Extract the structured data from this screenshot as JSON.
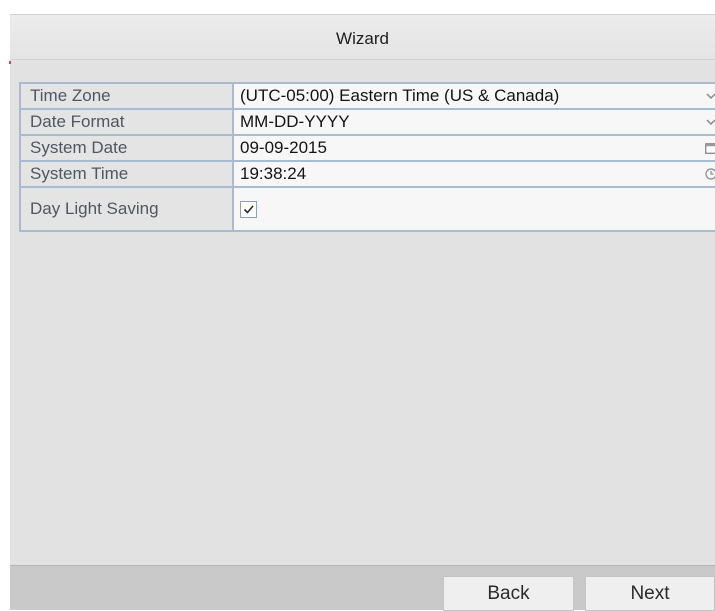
{
  "window": {
    "title": "Wizard"
  },
  "form": {
    "rows": [
      {
        "label": "Time Zone",
        "value": "(UTC-05:00) Eastern Time (US & Canada)",
        "control": "dropdown",
        "icon": "chevron-down-icon"
      },
      {
        "label": "Date Format",
        "value": "MM-DD-YYYY",
        "control": "dropdown",
        "icon": "chevron-down-icon"
      },
      {
        "label": "System Date",
        "value": "09-09-2015",
        "control": "date-picker",
        "icon": "calendar-icon"
      },
      {
        "label": "System Time",
        "value": "19:38:24",
        "control": "time-picker",
        "icon": "clock-icon"
      },
      {
        "label": "Day Light Saving",
        "checked": true,
        "control": "checkbox"
      }
    ]
  },
  "footer": {
    "back_label": "Back",
    "next_label": "Next"
  },
  "colors": {
    "border": "#aabad0",
    "label_text": "#4f5763",
    "panel_bg": "#e2e2e2",
    "footer_bg": "#c9c9c9",
    "accent": "#d23c8c"
  }
}
